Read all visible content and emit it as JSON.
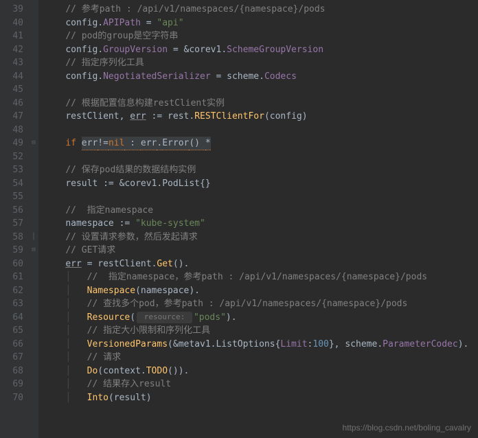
{
  "watermark": "https://blog.csdn.net/boling_cavalry",
  "lines": [
    {
      "n": 39,
      "fold": "",
      "tokens": [
        {
          "t": "    ",
          "c": ""
        },
        {
          "t": "// 参考path : /api/v1/namespaces/{namespace}/pods",
          "c": "c-comment"
        }
      ]
    },
    {
      "n": 40,
      "fold": "",
      "tokens": [
        {
          "t": "    ",
          "c": ""
        },
        {
          "t": "config",
          "c": "c-ident"
        },
        {
          "t": ".",
          "c": "c-op"
        },
        {
          "t": "APIPath",
          "c": "c-field"
        },
        {
          "t": " = ",
          "c": "c-op"
        },
        {
          "t": "\"api\"",
          "c": "c-string"
        }
      ]
    },
    {
      "n": 41,
      "fold": "",
      "tokens": [
        {
          "t": "    ",
          "c": ""
        },
        {
          "t": "// pod的group是空字符串",
          "c": "c-comment"
        }
      ]
    },
    {
      "n": 42,
      "fold": "",
      "tokens": [
        {
          "t": "    ",
          "c": ""
        },
        {
          "t": "config",
          "c": "c-ident"
        },
        {
          "t": ".",
          "c": "c-op"
        },
        {
          "t": "GroupVersion",
          "c": "c-field"
        },
        {
          "t": " = &",
          "c": "c-op"
        },
        {
          "t": "corev1",
          "c": "c-ident"
        },
        {
          "t": ".",
          "c": "c-op"
        },
        {
          "t": "SchemeGroupVersion",
          "c": "c-field"
        }
      ]
    },
    {
      "n": 43,
      "fold": "",
      "tokens": [
        {
          "t": "    ",
          "c": ""
        },
        {
          "t": "// 指定序列化工具",
          "c": "c-comment"
        }
      ]
    },
    {
      "n": 44,
      "fold": "",
      "tokens": [
        {
          "t": "    ",
          "c": ""
        },
        {
          "t": "config",
          "c": "c-ident"
        },
        {
          "t": ".",
          "c": "c-op"
        },
        {
          "t": "NegotiatedSerializer",
          "c": "c-field"
        },
        {
          "t": " = ",
          "c": "c-op"
        },
        {
          "t": "scheme",
          "c": "c-ident"
        },
        {
          "t": ".",
          "c": "c-op"
        },
        {
          "t": "Codecs",
          "c": "c-field"
        }
      ]
    },
    {
      "n": 45,
      "fold": "",
      "tokens": [
        {
          "t": " ",
          "c": ""
        }
      ]
    },
    {
      "n": 46,
      "fold": "",
      "tokens": [
        {
          "t": "    ",
          "c": ""
        },
        {
          "t": "// 根据配置信息构建restClient实例",
          "c": "c-comment"
        }
      ]
    },
    {
      "n": 47,
      "fold": "",
      "tokens": [
        {
          "t": "    ",
          "c": ""
        },
        {
          "t": "restClient",
          "c": "c-ident"
        },
        {
          "t": ", ",
          "c": "c-op"
        },
        {
          "t": "err",
          "c": "c-ident c-underline"
        },
        {
          "t": " := ",
          "c": "c-op"
        },
        {
          "t": "rest",
          "c": "c-ident"
        },
        {
          "t": ".",
          "c": "c-op"
        },
        {
          "t": "RESTClientFor",
          "c": "c-func"
        },
        {
          "t": "(",
          "c": "c-op"
        },
        {
          "t": "config",
          "c": "c-ident"
        },
        {
          "t": ")",
          "c": "c-op"
        }
      ]
    },
    {
      "n": 48,
      "fold": "",
      "tokens": [
        {
          "t": " ",
          "c": ""
        }
      ]
    },
    {
      "n": 49,
      "fold": "⊟",
      "tokens": [
        {
          "t": "    ",
          "c": ""
        },
        {
          "t": "if ",
          "c": "c-keyword"
        },
        {
          "t": "err",
          "c": "c-err"
        },
        {
          "t": "!=",
          "c": "c-err"
        },
        {
          "t": "nil",
          "c": "c-err c-keyword"
        },
        {
          "t": " : ",
          "c": "c-err"
        },
        {
          "t": "err",
          "c": "c-err"
        },
        {
          "t": ".",
          "c": "c-err"
        },
        {
          "t": "Error",
          "c": "c-err"
        },
        {
          "t": "() ",
          "c": "c-err"
        },
        {
          "t": "*",
          "c": "c-err"
        }
      ]
    },
    {
      "n": 52,
      "fold": "",
      "tokens": [
        {
          "t": " ",
          "c": ""
        }
      ]
    },
    {
      "n": 53,
      "fold": "",
      "tokens": [
        {
          "t": "    ",
          "c": ""
        },
        {
          "t": "// 保存pod结果的数据结构实例",
          "c": "c-comment"
        }
      ]
    },
    {
      "n": 54,
      "fold": "",
      "tokens": [
        {
          "t": "    ",
          "c": ""
        },
        {
          "t": "result",
          "c": "c-ident"
        },
        {
          "t": " := &",
          "c": "c-op"
        },
        {
          "t": "corev1",
          "c": "c-ident"
        },
        {
          "t": ".",
          "c": "c-op"
        },
        {
          "t": "PodList",
          "c": "c-type"
        },
        {
          "t": "{}",
          "c": "c-op"
        }
      ]
    },
    {
      "n": 55,
      "fold": "",
      "tokens": [
        {
          "t": " ",
          "c": ""
        }
      ]
    },
    {
      "n": 56,
      "fold": "",
      "tokens": [
        {
          "t": "    ",
          "c": ""
        },
        {
          "t": "//  指定namespace",
          "c": "c-comment"
        }
      ]
    },
    {
      "n": 57,
      "fold": "",
      "tokens": [
        {
          "t": "    ",
          "c": ""
        },
        {
          "t": "namespace",
          "c": "c-ident"
        },
        {
          "t": " := ",
          "c": "c-op"
        },
        {
          "t": "\"kube-system\"",
          "c": "c-string"
        }
      ]
    },
    {
      "n": 58,
      "fold": "│",
      "tokens": [
        {
          "t": "    ",
          "c": ""
        },
        {
          "t": "// 设置请求参数，然后发起请求",
          "c": "c-comment"
        }
      ]
    },
    {
      "n": 59,
      "fold": "⊟",
      "tokens": [
        {
          "t": "    ",
          "c": ""
        },
        {
          "t": "// GET请求",
          "c": "c-comment"
        }
      ]
    },
    {
      "n": 60,
      "fold": "",
      "tokens": [
        {
          "t": "    ",
          "c": ""
        },
        {
          "t": "err",
          "c": "c-ident c-underline"
        },
        {
          "t": " = ",
          "c": "c-op"
        },
        {
          "t": "restClient",
          "c": "c-ident"
        },
        {
          "t": ".",
          "c": "c-op"
        },
        {
          "t": "Get",
          "c": "c-func"
        },
        {
          "t": "().",
          "c": "c-op"
        }
      ]
    },
    {
      "n": 61,
      "fold": "",
      "tokens": [
        {
          "t": "    ",
          "c": ""
        },
        {
          "t": "│   ",
          "c": "guide"
        },
        {
          "t": "//  指定namespace，参考path : /api/v1/namespaces/{namespace}/pods",
          "c": "c-comment"
        }
      ]
    },
    {
      "n": 62,
      "fold": "",
      "tokens": [
        {
          "t": "    ",
          "c": ""
        },
        {
          "t": "│   ",
          "c": "guide"
        },
        {
          "t": "Namespace",
          "c": "c-func"
        },
        {
          "t": "(",
          "c": "c-op"
        },
        {
          "t": "namespace",
          "c": "c-ident"
        },
        {
          "t": ").",
          "c": "c-op"
        }
      ]
    },
    {
      "n": 63,
      "fold": "",
      "tokens": [
        {
          "t": "    ",
          "c": ""
        },
        {
          "t": "│   ",
          "c": "guide"
        },
        {
          "t": "// 查找多个pod，参考path : /api/v1/namespaces/{namespace}/pods",
          "c": "c-comment"
        }
      ]
    },
    {
      "n": 64,
      "fold": "",
      "tokens": [
        {
          "t": "    ",
          "c": ""
        },
        {
          "t": "│   ",
          "c": "guide"
        },
        {
          "t": "Resource",
          "c": "c-func"
        },
        {
          "t": "(",
          "c": "c-op"
        },
        {
          "t": " resource: ",
          "c": "c-hint"
        },
        {
          "t": "\"pods\"",
          "c": "c-string"
        },
        {
          "t": ").",
          "c": "c-op"
        }
      ]
    },
    {
      "n": 65,
      "fold": "",
      "tokens": [
        {
          "t": "    ",
          "c": ""
        },
        {
          "t": "│   ",
          "c": "guide"
        },
        {
          "t": "// 指定大小限制和序列化工具",
          "c": "c-comment"
        }
      ]
    },
    {
      "n": 66,
      "fold": "",
      "tokens": [
        {
          "t": "    ",
          "c": ""
        },
        {
          "t": "│   ",
          "c": "guide"
        },
        {
          "t": "VersionedParams",
          "c": "c-func"
        },
        {
          "t": "(&",
          "c": "c-op"
        },
        {
          "t": "metav1",
          "c": "c-ident"
        },
        {
          "t": ".",
          "c": "c-op"
        },
        {
          "t": "ListOptions",
          "c": "c-type"
        },
        {
          "t": "{",
          "c": "c-op"
        },
        {
          "t": "Limit",
          "c": "c-field"
        },
        {
          "t": ":",
          "c": "c-op"
        },
        {
          "t": "100",
          "c": "c-num"
        },
        {
          "t": "}, ",
          "c": "c-op"
        },
        {
          "t": "scheme",
          "c": "c-ident"
        },
        {
          "t": ".",
          "c": "c-op"
        },
        {
          "t": "ParameterCodec",
          "c": "c-field"
        },
        {
          "t": ").",
          "c": "c-op"
        }
      ]
    },
    {
      "n": 67,
      "fold": "",
      "tokens": [
        {
          "t": "    ",
          "c": ""
        },
        {
          "t": "│   ",
          "c": "guide"
        },
        {
          "t": "// 请求",
          "c": "c-comment"
        }
      ]
    },
    {
      "n": 68,
      "fold": "",
      "tokens": [
        {
          "t": "    ",
          "c": ""
        },
        {
          "t": "│   ",
          "c": "guide"
        },
        {
          "t": "Do",
          "c": "c-func"
        },
        {
          "t": "(",
          "c": "c-op"
        },
        {
          "t": "context",
          "c": "c-ident"
        },
        {
          "t": ".",
          "c": "c-op"
        },
        {
          "t": "TODO",
          "c": "c-func"
        },
        {
          "t": "()).",
          "c": "c-op"
        }
      ]
    },
    {
      "n": 69,
      "fold": "",
      "tokens": [
        {
          "t": "    ",
          "c": ""
        },
        {
          "t": "│   ",
          "c": "guide"
        },
        {
          "t": "// 结果存入result",
          "c": "c-comment"
        }
      ]
    },
    {
      "n": 70,
      "fold": "",
      "tokens": [
        {
          "t": "    ",
          "c": ""
        },
        {
          "t": "│   ",
          "c": "guide"
        },
        {
          "t": "Into",
          "c": "c-func"
        },
        {
          "t": "(",
          "c": "c-op"
        },
        {
          "t": "result",
          "c": "c-ident"
        },
        {
          "t": ")",
          "c": "c-op"
        }
      ]
    }
  ]
}
